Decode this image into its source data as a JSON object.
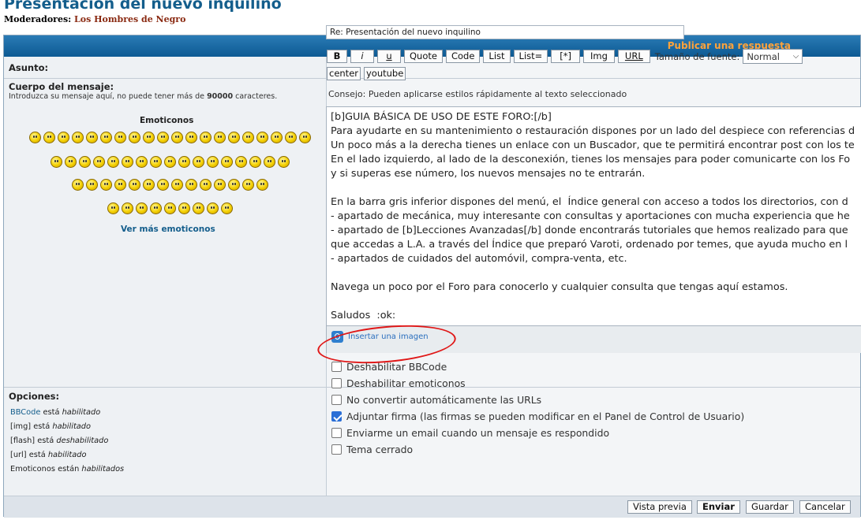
{
  "header": {
    "title": "Presentación del nuevo inquilino",
    "moderators_label": "Moderadores:",
    "moderators_value": "Los Hombres de Negro"
  },
  "panel": {
    "title": "Publicar una respuesta"
  },
  "subject": {
    "label": "Asunto:",
    "value": "Re: Presentación del nuevo inquilino"
  },
  "body": {
    "label": "Cuerpo del mensaje:",
    "hint_prefix": "Introduzca su mensaje aquí, no puede tener más de",
    "hint_number": "90000",
    "hint_suffix": "caracteres.",
    "emoticons_title": "Emoticonos",
    "more_emoticons": "Ver más emoticonos"
  },
  "toolbar": {
    "buttons": [
      "B",
      "i",
      "u",
      "Quote",
      "Code",
      "List",
      "List=",
      "[*]",
      "Img",
      "URL"
    ],
    "font_size_label": "Tamaño de fuente:",
    "font_size_value": "Normal",
    "buttons_row2": [
      "center",
      "youtube"
    ],
    "tip": "Consejo: Pueden aplicarse estilos rápidamente al texto seleccionado"
  },
  "message": {
    "text": "[b]GUIA BÁSICA DE USO DE ESTE FORO:[/b]\nPara ayudarte en su mantenimiento o restauración dispones por un lado del despiece con referencias d\nUn poco más a la derecha tienes un enlace con un Buscador, que te permitirá encontrar post con los te\nEn el lado izquierdo, al lado de la desconexión, tienes los mensajes para poder comunicarte con los Fo\ny si superas ese número, los nuevos mensajes no te entrarán.\n\nEn la barra gris inferior dispones del menú, el  Índice general con acceso a todos los directorios, con d\n- apartado de mecánica, muy interesante con consultas y aportaciones con mucha experiencia que he\n- apartado de [b]Lecciones Avanzadas[/b] donde encontrarás tutoriales que hemos realizado para que\nque accedas a L.A. a través del Índice que preparó Varoti, ordenado por temes, que ayuda mucho en l\n- apartados de cuidados del automóvil, compra-venta, etc.\n\nNavega un poco por el Foro para conocerlo y cualquier consulta que tengas aquí estamos.\n\nSaludos  :ok:",
    "insert_image": "Insertar una imagen"
  },
  "options": {
    "label": "Opciones:",
    "status": [
      {
        "prefix": "BBCode",
        "middle": " está ",
        "state": "habilitado"
      },
      {
        "prefix": "[img]",
        "middle": " está ",
        "state": "habilitado"
      },
      {
        "prefix": "[flash]",
        "middle": " está ",
        "state": "deshabilitado"
      },
      {
        "prefix": "[url]",
        "middle": " está ",
        "state": "habilitado"
      },
      {
        "prefix": "Emoticonos",
        "middle": " están ",
        "state": "habilitados"
      }
    ],
    "checkboxes": [
      {
        "label": "Deshabilitar BBCode",
        "checked": false
      },
      {
        "label": "Deshabilitar emoticonos",
        "checked": false
      },
      {
        "label": "No convertir automáticamente las URLs",
        "checked": false
      },
      {
        "label": "Adjuntar firma (las firmas se pueden modificar en el Panel de Control de Usuario)",
        "checked": true
      },
      {
        "label": "Enviarme un email cuando un mensaje es respondido",
        "checked": false
      },
      {
        "label": "Tema cerrado",
        "checked": false
      }
    ]
  },
  "actions": {
    "preview": "Vista previa",
    "send": "Enviar",
    "save": "Guardar",
    "cancel": "Cancelar"
  }
}
